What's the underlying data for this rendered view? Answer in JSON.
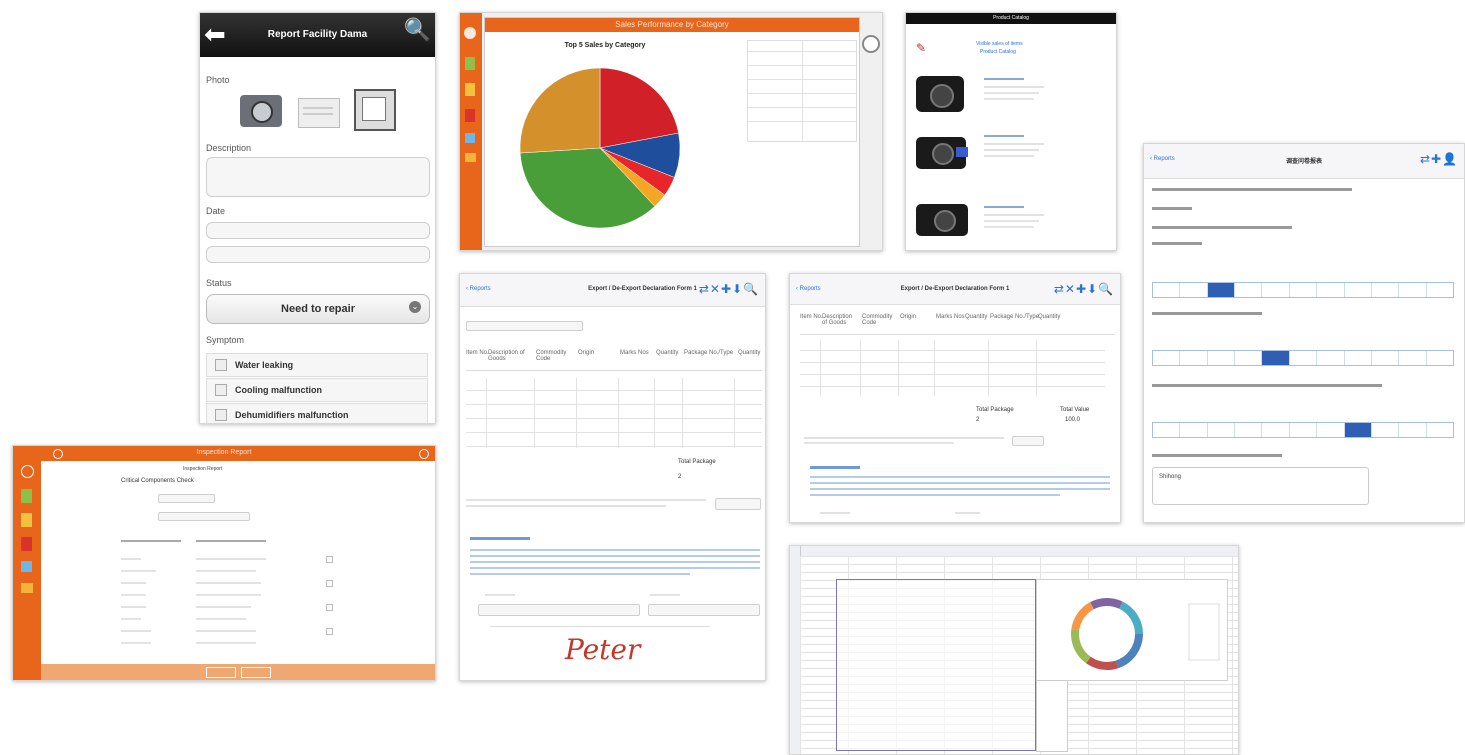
{
  "facility": {
    "title": "Report Facility Dama",
    "photo_label": "Photo",
    "description_label": "Description",
    "date_label": "Date",
    "status_label": "Status",
    "status_value": "Need to repair",
    "symptom_label": "Symptom",
    "symptoms": [
      "Water leaking",
      "Cooling malfunction",
      "Dehumidifiers malfunction"
    ]
  },
  "sales": {
    "title": "Sales Performance by Category",
    "chart_title": "Top 5 Sales by Category"
  },
  "chart_data": {
    "type": "pie",
    "title": "Top 5 Sales by Category",
    "categories": [
      "red",
      "blue",
      "red-small",
      "yellow",
      "green",
      "gold"
    ],
    "values": [
      22,
      9,
      4,
      3,
      36,
      26
    ],
    "colors": [
      "#d22028",
      "#1f4e9c",
      "#e8262a",
      "#f5a623",
      "#4a9e3a",
      "#d4902a"
    ]
  },
  "catalog": {
    "title": "Product Catalog",
    "header_link": "Visible sales of items",
    "header_sub": "Product Catalog"
  },
  "inspection": {
    "title": "Inspection Report",
    "subtitle": "Inspection Report",
    "section": "Critical Components Check",
    "footer_buttons": [
      "",
      ""
    ]
  },
  "export1": {
    "back": "Reports",
    "title": "Export / De-Export Declaration Form 1",
    "total_label": "Total Package",
    "total_value": "2",
    "signature": "Peter",
    "columns": [
      "Item No.",
      "Description of Goods",
      "Commodity Code",
      "Origin",
      "Marks Nos",
      "Quantity",
      "Package No./Type",
      "Quantity"
    ]
  },
  "export2": {
    "back": "Reports",
    "title": "Export / De-Export Declaration Form 1",
    "total_label": "Total Package",
    "total_value_label": "Total Value",
    "total_value": "2",
    "total_value_2": "100.0"
  },
  "survey": {
    "back": "Reports",
    "title": "调查问卷报表",
    "question_final": "Shihong"
  },
  "colors": {
    "accent_orange": "#e8661c",
    "ios_blue": "#2c73d2",
    "selected_blue": "#2f5fb3"
  }
}
